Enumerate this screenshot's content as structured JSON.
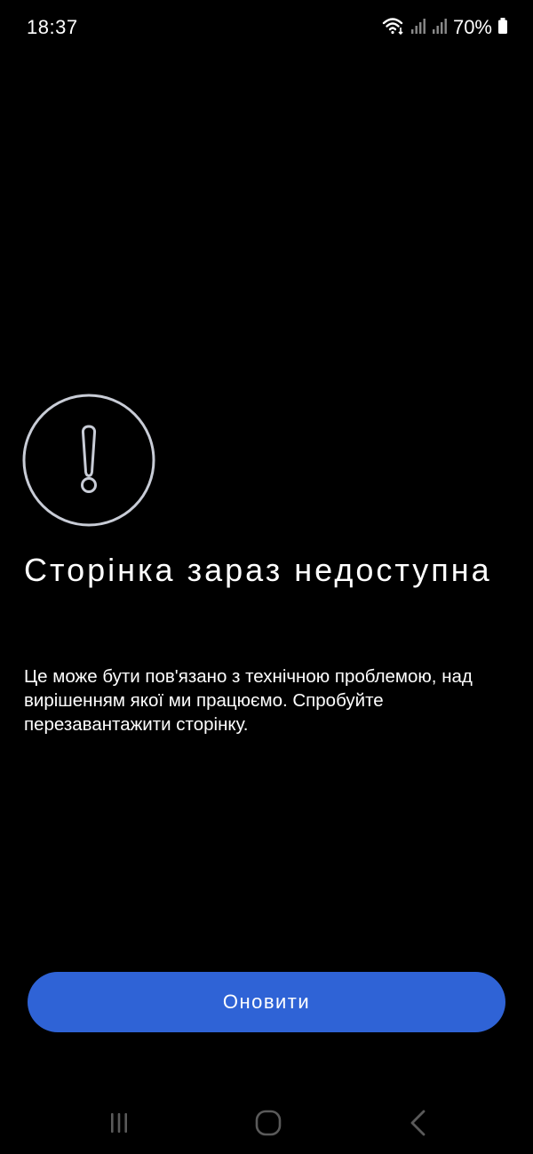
{
  "status_bar": {
    "time": "18:37",
    "battery_percent": "70%",
    "icons": [
      "wifi-icon",
      "signal-icon",
      "signal-icon",
      "battery-icon"
    ]
  },
  "error": {
    "icon": "exclamation-circle-icon",
    "title": "Сторінка зараз недоступна",
    "description": "Це може бути пов'язано з технічною проблемою, над вирішенням якої ми працюємо. Спробуйте перезавантажити сторінку."
  },
  "actions": {
    "refresh_label": "Оновити"
  },
  "nav_bar": {
    "icons": [
      "recent-apps-icon",
      "home-icon",
      "back-icon"
    ]
  },
  "colors": {
    "background": "#000000",
    "text": "#ffffff",
    "accent": "#2f63d6",
    "icon_stroke": "#c8ccd6"
  }
}
